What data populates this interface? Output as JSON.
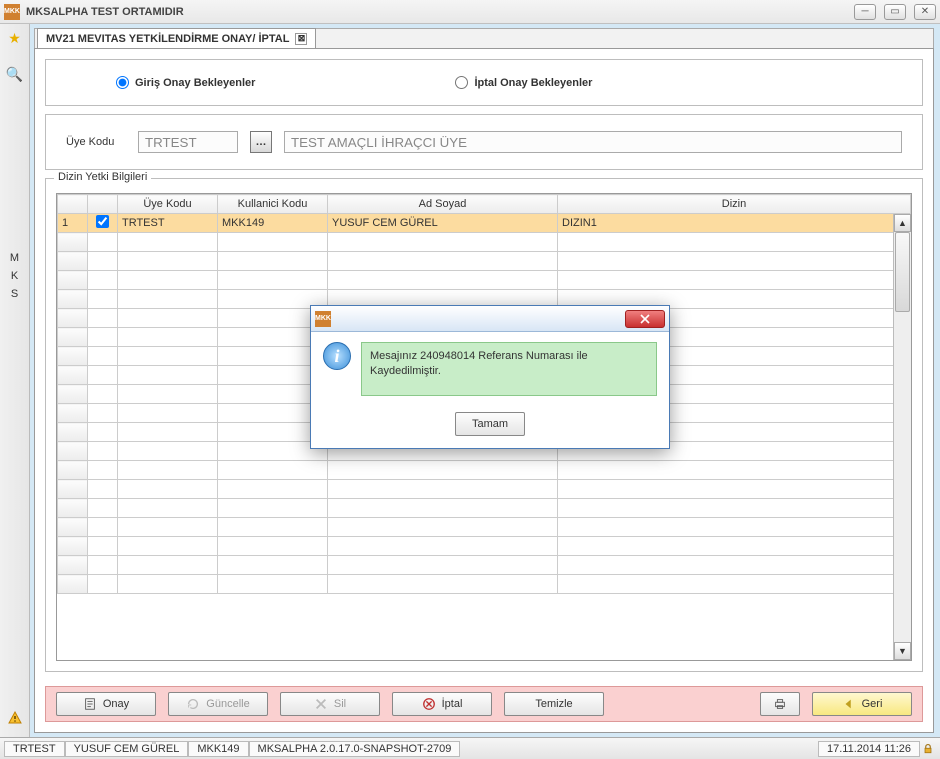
{
  "window": {
    "title": "MKSALPHA TEST ORTAMIDIR",
    "app_abbr": "MKK"
  },
  "tab": {
    "label": "MV21 MEVITAS YETKİLENDİRME ONAY/ İPTAL"
  },
  "left_rail": {
    "letters": [
      "M",
      "K",
      "S"
    ]
  },
  "radios": {
    "giris": "Giriş Onay Bekleyenler",
    "iptal": "İptal Onay Bekleyenler",
    "selected": "giris"
  },
  "filter": {
    "label": "Üye Kodu",
    "code_value": "TRTEST",
    "desc_value": "TEST AMAÇLI İHRAÇCI ÜYE"
  },
  "grid": {
    "legend": "Dizin Yetki Bilgileri",
    "headers": [
      "Üye Kodu",
      "Kullanici Kodu",
      "Ad Soyad",
      "Dizin"
    ],
    "rows": [
      {
        "num": "1",
        "checked": true,
        "cells": [
          "TRTEST",
          "MKK149",
          "YUSUF CEM GÜREL",
          "DIZIN1"
        ]
      }
    ],
    "empty_rows": 19
  },
  "buttons": {
    "onay": "Onay",
    "guncelle": "Güncelle",
    "sil": "Sil",
    "iptal": "İptal",
    "temizle": "Temizle",
    "geri": "Geri"
  },
  "dialog": {
    "message": "Mesajınız 240948014 Referans Numarası ile Kaydedilmiştir.",
    "ok": "Tamam"
  },
  "status": {
    "user_code": "TRTEST",
    "user_name": "YUSUF CEM GÜREL",
    "user_id": "MKK149",
    "version": "MKSALPHA 2.0.17.0-SNAPSHOT-2709",
    "datetime": "17.11.2014 11:26"
  }
}
